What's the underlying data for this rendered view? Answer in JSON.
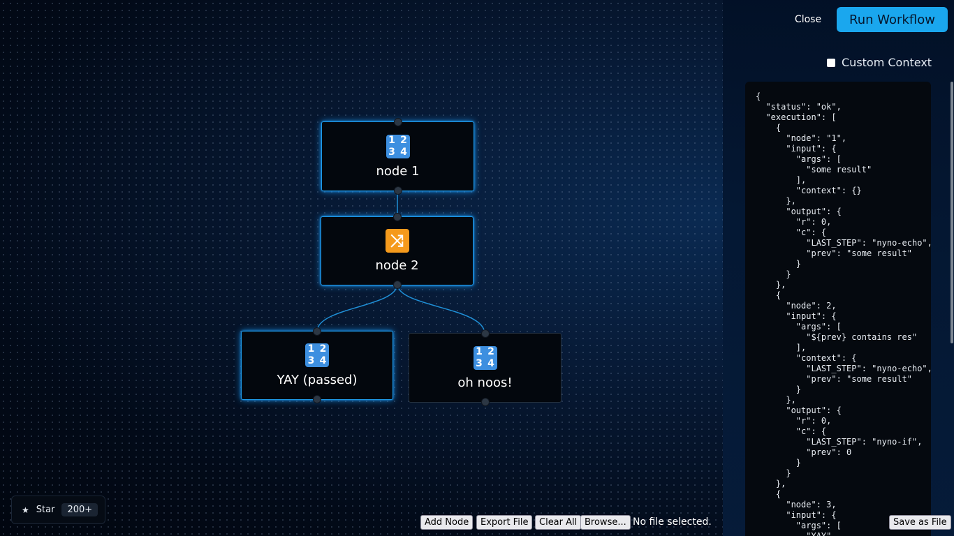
{
  "toolbar": {
    "close_label": "Close",
    "run_label": "Run Workflow",
    "custom_context_label": "Custom Context",
    "custom_context_checked": false
  },
  "nodes": [
    {
      "id": "1",
      "label": "node 1",
      "icon": "input-numbers-icon",
      "highlighted": true
    },
    {
      "id": "2",
      "label": "node 2",
      "icon": "shuffle-icon",
      "highlighted": true
    },
    {
      "id": "3",
      "label": "YAY (passed)",
      "icon": "input-numbers-icon",
      "highlighted": true
    },
    {
      "id": "4",
      "label": "oh noos!",
      "icon": "input-numbers-icon",
      "highlighted": false
    }
  ],
  "edges": [
    {
      "from": "node 1",
      "to": "node 2"
    },
    {
      "from": "node 2",
      "to": "YAY (passed)"
    },
    {
      "from": "node 2",
      "to": "oh noos!"
    }
  ],
  "numbers_icon_digits": [
    "1",
    "2",
    "3",
    "4"
  ],
  "shuffle_glyph": "⤨",
  "json_output": "{\n  \"status\": \"ok\",\n  \"execution\": [\n    {\n      \"node\": \"1\",\n      \"input\": {\n        \"args\": [\n          \"some result\"\n        ],\n        \"context\": {}\n      },\n      \"output\": {\n        \"r\": 0,\n        \"c\": {\n          \"LAST_STEP\": \"nyno-echo\",\n          \"prev\": \"some result\"\n        }\n      }\n    },\n    {\n      \"node\": 2,\n      \"input\": {\n        \"args\": [\n          \"${prev} contains res\"\n        ],\n        \"context\": {\n          \"LAST_STEP\": \"nyno-echo\",\n          \"prev\": \"some result\"\n        }\n      },\n      \"output\": {\n        \"r\": 0,\n        \"c\": {\n          \"LAST_STEP\": \"nyno-if\",\n          \"prev\": 0\n        }\n      }\n    },\n    {\n      \"node\": 3,\n      \"input\": {\n        \"args\": [\n          \"YAY\"",
  "bottom_bar": {
    "add_node": "Add Node",
    "export_file": "Export File",
    "clear_all": "Clear All",
    "browse": "Browse...",
    "file_status": "No file selected.",
    "save_as_file": "Save as File"
  },
  "star": {
    "icon": "star-icon",
    "label": "Star",
    "count": "200+"
  },
  "colors": {
    "accent": "#1aa7ee",
    "node_glow": "#1f9bea",
    "numbers_icon": "#3d8fe0",
    "shuffle_icon": "#f59a1c"
  }
}
